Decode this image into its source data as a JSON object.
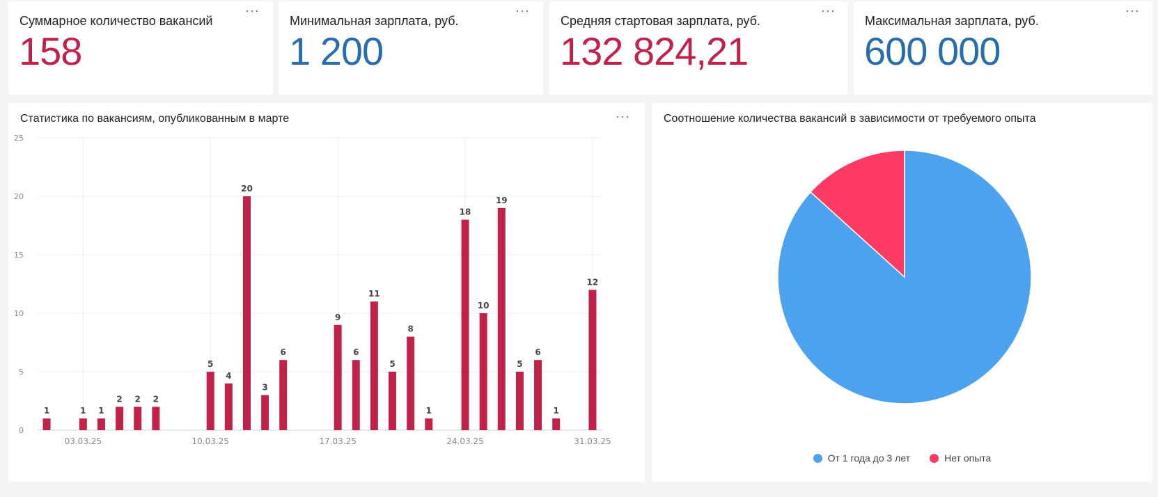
{
  "kpis": [
    {
      "title": "Суммарное количество вакансий",
      "value": "158",
      "color": "#c0224a"
    },
    {
      "title": "Минимальная зарплата, руб.",
      "value": "1 200",
      "color": "#2a6dad"
    },
    {
      "title": "Средняя стартовая зарплата, руб.",
      "value": "132 824,21",
      "color": "#c0224a"
    },
    {
      "title": "Максимальная зарплата, руб.",
      "value": "600 000",
      "color": "#2a6dad"
    }
  ],
  "menu_label": "···",
  "chart_data": [
    {
      "type": "bar",
      "title": "Статистика по вакансиям, опубликованным в марте",
      "xlabel": "",
      "ylabel": "",
      "ylim": [
        0,
        25
      ],
      "yticks": [
        0,
        5,
        10,
        15,
        20,
        25
      ],
      "x_ticks": [
        "03.03.25",
        "10.03.25",
        "17.03.25",
        "24.03.25",
        "31.03.25"
      ],
      "grid": true,
      "bar_color": "#c0224a",
      "points": [
        {
          "date": "01.03.25",
          "value": 1
        },
        {
          "date": "03.03.25",
          "value": 1
        },
        {
          "date": "04.03.25",
          "value": 1
        },
        {
          "date": "05.03.25",
          "value": 2
        },
        {
          "date": "06.03.25",
          "value": 2
        },
        {
          "date": "07.03.25",
          "value": 2
        },
        {
          "date": "10.03.25",
          "value": 5
        },
        {
          "date": "11.03.25",
          "value": 4
        },
        {
          "date": "12.03.25",
          "value": 20
        },
        {
          "date": "13.03.25",
          "value": 3
        },
        {
          "date": "14.03.25",
          "value": 6
        },
        {
          "date": "17.03.25",
          "value": 9
        },
        {
          "date": "18.03.25",
          "value": 6
        },
        {
          "date": "19.03.25",
          "value": 11
        },
        {
          "date": "20.03.25",
          "value": 5
        },
        {
          "date": "21.03.25",
          "value": 8
        },
        {
          "date": "22.03.25",
          "value": 1
        },
        {
          "date": "24.03.25",
          "value": 18
        },
        {
          "date": "25.03.25",
          "value": 10
        },
        {
          "date": "26.03.25",
          "value": 19
        },
        {
          "date": "27.03.25",
          "value": 5
        },
        {
          "date": "28.03.25",
          "value": 6
        },
        {
          "date": "29.03.25",
          "value": 1
        },
        {
          "date": "31.03.25",
          "value": 12
        }
      ]
    },
    {
      "type": "pie",
      "title": "Соотношение количества вакансий в зависимости от требуемого опыта",
      "legend_position": "bottom",
      "slices": [
        {
          "label": "От 1 года до 3 лет",
          "value": 137,
          "color": "#4da2ef"
        },
        {
          "label": "Нет опыта",
          "value": 21,
          "color": "#ff3b63"
        }
      ]
    }
  ]
}
